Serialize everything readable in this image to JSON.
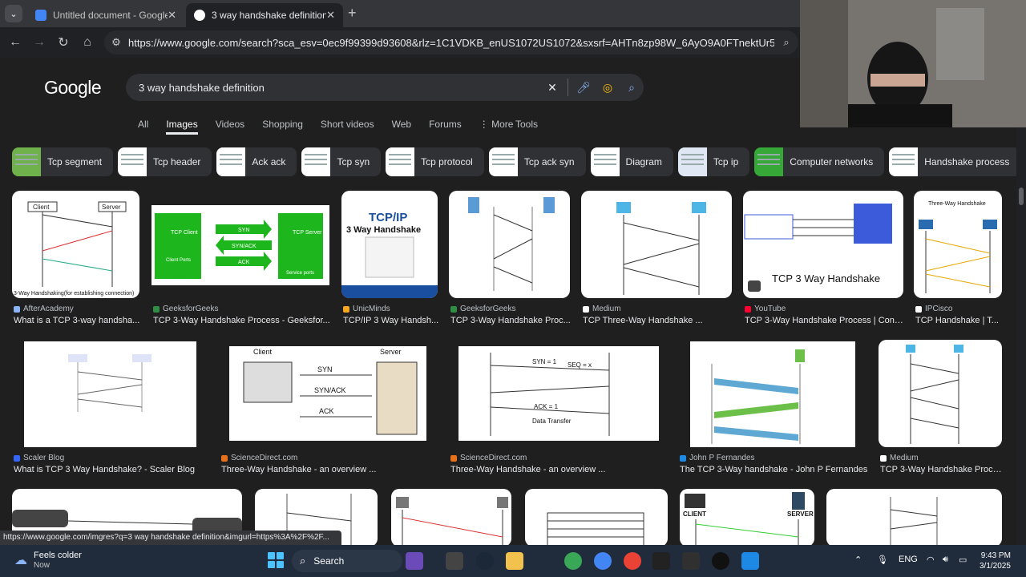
{
  "browser": {
    "tabs": [
      {
        "title": "Untitled document - Google Do",
        "favicon_color": "#4285f4"
      },
      {
        "title": "3 way handshake definition - G",
        "favicon_color": "#ffffff"
      }
    ],
    "url": "https://www.google.com/search?sca_esv=0ec9f99399d93608&rlz=1C1VDKB_enUS1072US1072&sxsrf=AHTn8zp98W_6AyO9A0FTnektUr5RtvarHw:1740883...",
    "status_url": "https://www.google.com/imgres?q=3 way handshake definition&imgurl=https%3A%2F%2F..."
  },
  "google": {
    "logo": "Google",
    "query": "3 way handshake definition",
    "tabs": [
      "All",
      "Images",
      "Videos",
      "Shopping",
      "Short videos",
      "Web",
      "Forums",
      "More"
    ],
    "active_tab": "Images",
    "tools": "Tools",
    "chips": [
      "Tcp segment",
      "Tcp header",
      "Ack ack",
      "Tcp syn",
      "Tcp protocol",
      "Tcp ack syn",
      "Diagram",
      "Tcp ip",
      "Computer networks",
      "Handshake process"
    ]
  },
  "results": [
    {
      "source": "AfterAcademy",
      "title": "What is a TCP 3-way handsha...",
      "accent": "#ffffff"
    },
    {
      "source": "GeeksforGeeks",
      "title": "TCP 3-Way Handshake Process - Geeksfor...",
      "accent": "#18b618"
    },
    {
      "source": "UnicMinds",
      "title": "TCP/IP 3 Way Handsh...",
      "accent": "#1a4fa0"
    },
    {
      "source": "GeeksforGeeks",
      "title": "TCP 3-Way Handshake Proc...",
      "accent": "#ffffff"
    },
    {
      "source": "Medium",
      "title": "TCP Three-Way Handshake ...",
      "accent": "#ffffff"
    },
    {
      "source": "YouTube",
      "title": "TCP 3-Way Handshake Process | Conc...",
      "accent": "#ffffff"
    },
    {
      "source": "IPCisco",
      "title": "TCP Handshake | T...",
      "accent": "#ffffff"
    },
    {
      "source": "Scaler Blog",
      "title": "What is TCP 3 Way Handshake? - Scaler Blog",
      "accent": "#ffffff"
    },
    {
      "source": "ScienceDirect.com",
      "title": "Three-Way Handshake - an overview ...",
      "accent": "#ffffff"
    },
    {
      "source": "ScienceDirect.com",
      "title": "Three-Way Handshake - an overview ...",
      "accent": "#ffffff"
    },
    {
      "source": "John P Fernandes",
      "title": "The TCP 3-Way handshake - John P Fernandes",
      "accent": "#ffffff"
    },
    {
      "source": "Medium",
      "title": "TCP 3-Way Handshake Proce...",
      "accent": "#ffffff"
    }
  ],
  "image_text": {
    "r1c1_client": "Client",
    "r1c1_server": "Server",
    "r1c1_caption": "3-Way Handshaking(for establishing connection)",
    "r1c2_tcp_client": "TCP Client",
    "r1c2_tcp_server": "TCP Server",
    "r1c2_syn": "SYN",
    "r1c2_synack": "SYN/ACK",
    "r1c2_ack": "ACK",
    "r1c2_client_ports": "Client Ports",
    "r1c2_service_ports": "Service ports",
    "r1c3_line1": "TCP/IP",
    "r1c3_line2": "3 Way Handshake",
    "r1c6_caption": "TCP 3 Way Handshake",
    "r1c7_title": "Three-Way Handshake",
    "r2c2_client": "Client",
    "r2c2_server": "Server",
    "r2c2_syn": "SYN",
    "r2c2_synack": "SYN/ACK",
    "r2c2_ack": "ACK",
    "r2c3_syn": "SYN = 1",
    "r2c3_seq": "SEQ = x",
    "r2c3_ack": "ACK = 1",
    "r2c3_data": "Data Transfer",
    "r3c5_client": "CLIENT",
    "r3c5_server": "SERVER"
  },
  "taskbar": {
    "weather_title": "Feels colder",
    "weather_sub": "Now",
    "search": "Search",
    "lang": "ENG",
    "time": "9:43 PM",
    "date": "3/1/2025"
  }
}
